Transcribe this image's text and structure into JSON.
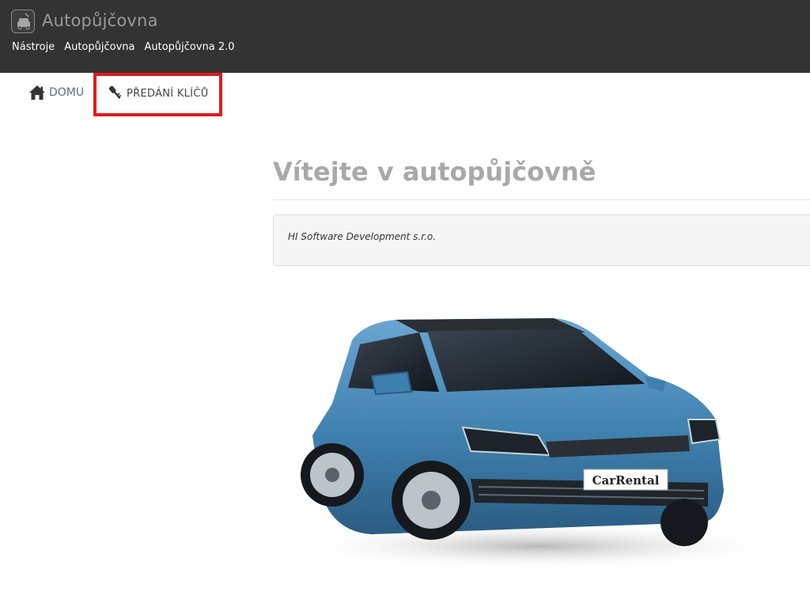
{
  "app": {
    "title": "Autopůjčovna",
    "menu": [
      "Nástroje",
      "Autopůjčovna",
      "Autopůjčovna 2.0"
    ]
  },
  "nav": {
    "home_label": "DOMU",
    "keys_label": "PŘEDÁNÍ KLÍČŮ"
  },
  "main": {
    "title": "Vítejte v autopůjčovně",
    "info_text": "HI Software Development s.r.o.",
    "car_plate": "CarRental"
  },
  "colors": {
    "appbar": "#333333",
    "highlight": "#e01b1b",
    "title": "#a9a9a9",
    "car_body": "#3f7fae"
  },
  "icons": {
    "app": "car-wash-icon",
    "home": "home-icon",
    "keys": "key-icon"
  }
}
